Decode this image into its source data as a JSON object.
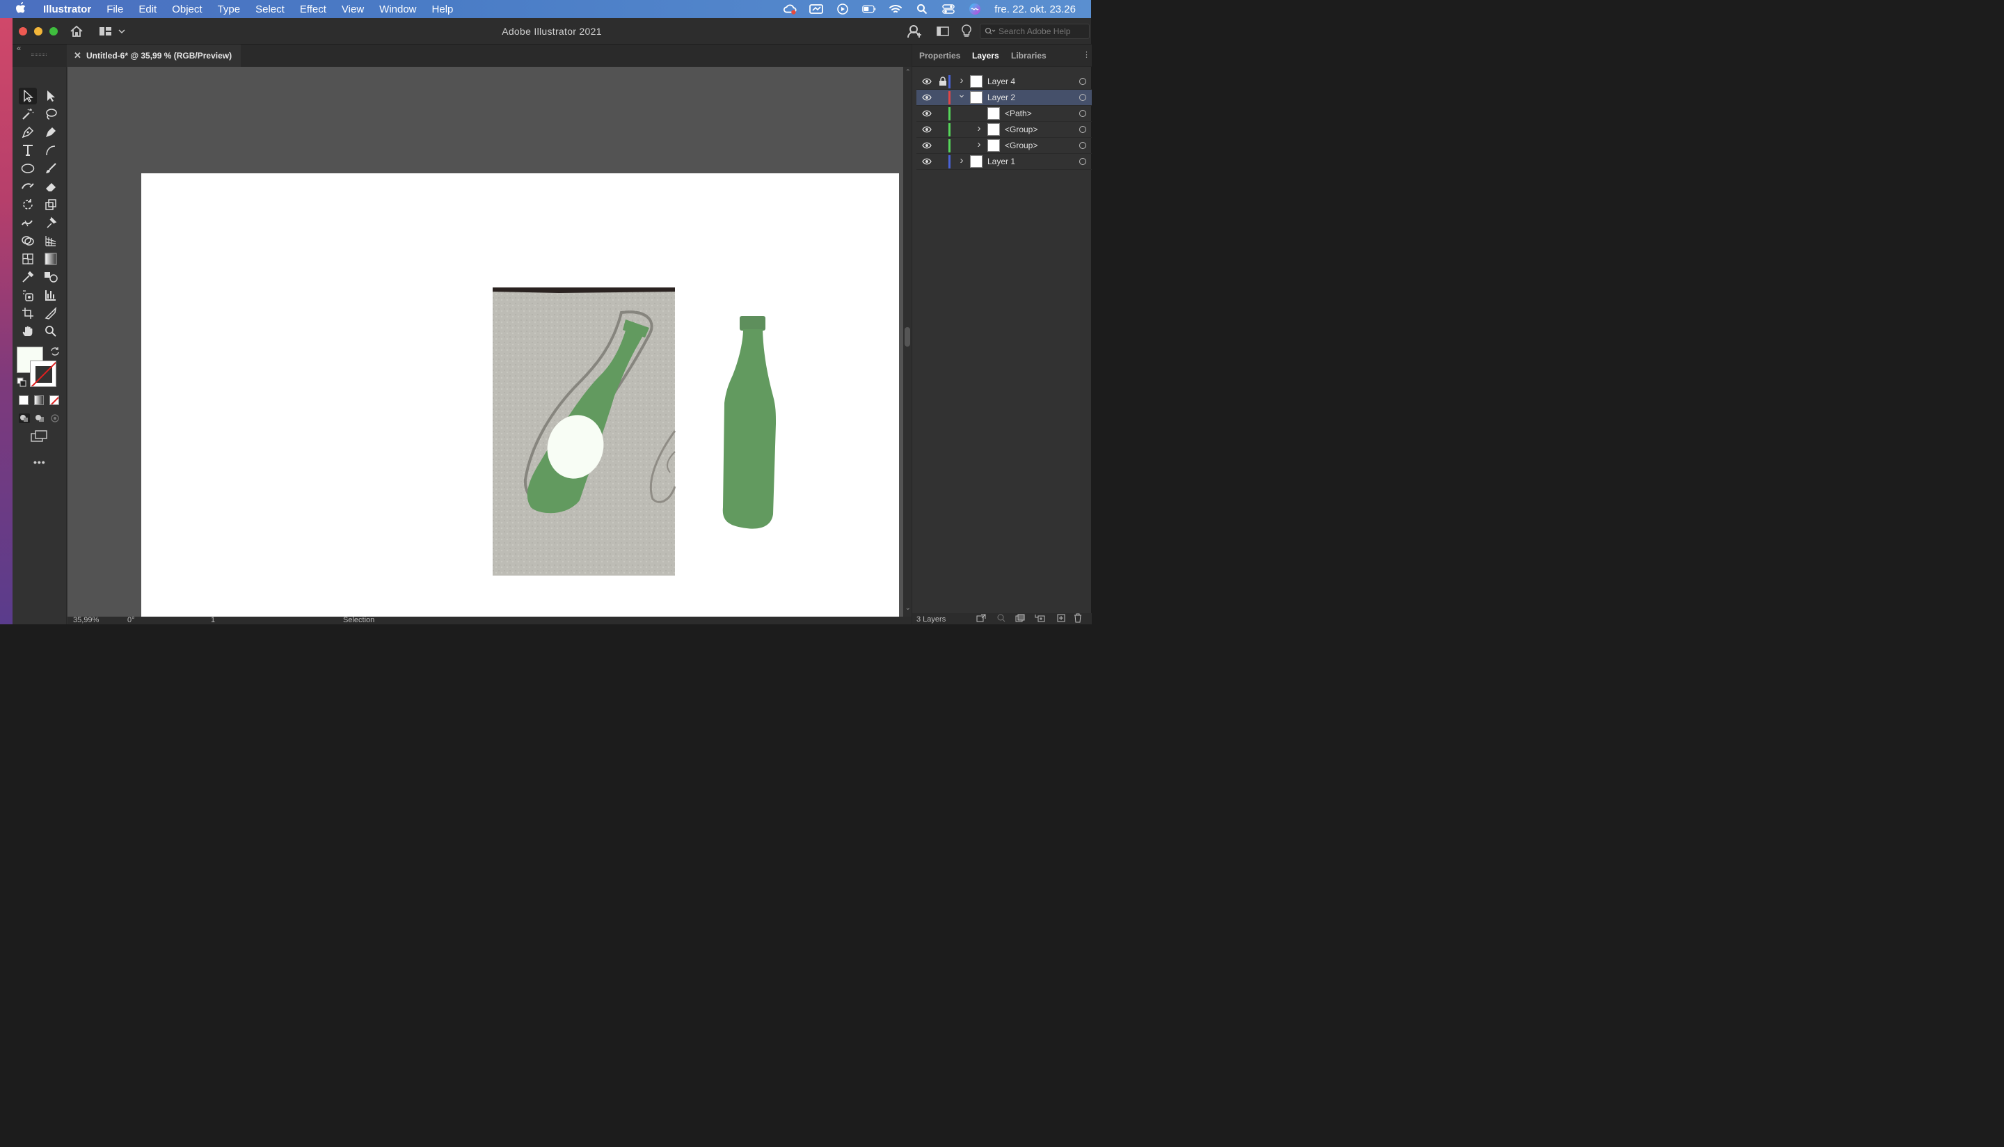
{
  "menubar": {
    "app_name": "Illustrator",
    "items": [
      "File",
      "Edit",
      "Object",
      "Type",
      "Select",
      "Effect",
      "View",
      "Window",
      "Help"
    ],
    "clock": "fre. 22. okt. 23.26"
  },
  "window": {
    "title": "Adobe Illustrator 2021",
    "help_search_placeholder": "Search Adobe Help"
  },
  "document_tab": {
    "label": "Untitled-6* @ 35,99 % (RGB/Preview)"
  },
  "panel": {
    "tabs": [
      "Properties",
      "Layers",
      "Libraries"
    ],
    "active_tab": "Layers",
    "layers": [
      {
        "name": "Layer 4",
        "color": "#4a63d6",
        "expanded": false,
        "locked": true,
        "selected": false,
        "indent": 0
      },
      {
        "name": "Layer 2",
        "color": "#e04646",
        "expanded": true,
        "locked": false,
        "selected": true,
        "indent": 0
      },
      {
        "name": "<Path>",
        "color": "#56d65a",
        "expanded": false,
        "locked": false,
        "selected": false,
        "indent": 1
      },
      {
        "name": "<Group>",
        "color": "#56d65a",
        "expanded": false,
        "locked": false,
        "selected": false,
        "indent": 1
      },
      {
        "name": "<Group>",
        "color": "#56d65a",
        "expanded": false,
        "locked": false,
        "selected": false,
        "indent": 1
      },
      {
        "name": "Layer 1",
        "color": "#4a63d6",
        "expanded": false,
        "locked": false,
        "selected": false,
        "indent": 0
      }
    ],
    "footer_count": "3 Layers"
  },
  "status": {
    "zoom": "35,99%",
    "rotation": "0°",
    "artboard": "1",
    "tool": "Selection"
  },
  "colors": {
    "bottle_green": "#629a5f",
    "label_white": "#f8fdf5"
  }
}
